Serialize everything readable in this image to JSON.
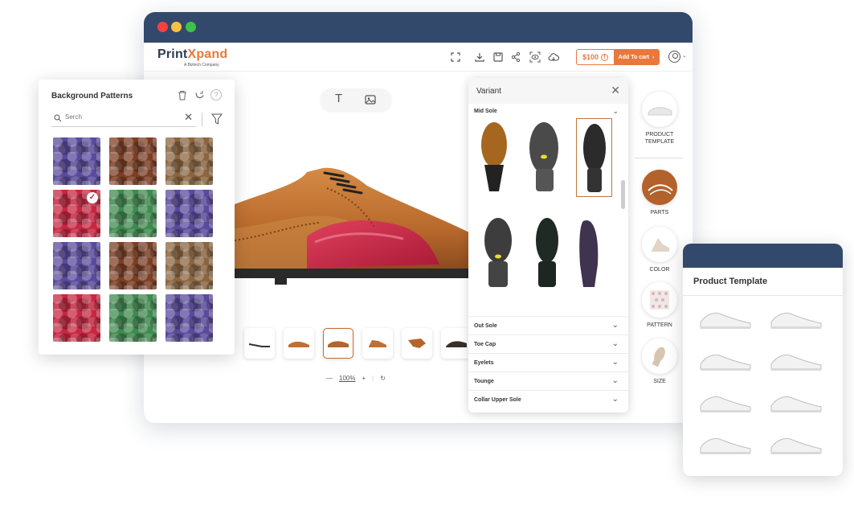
{
  "window": {
    "logo_main": "Print",
    "logo_accent": "Xpand",
    "logo_sub": "A Biztech Company"
  },
  "toolbar": {
    "icons": [
      "fullscreen-icon",
      "download-icon",
      "save-icon",
      "share-icon",
      "preview-icon",
      "cloud-icon"
    ],
    "price": "$100",
    "add_to_cart": "Add To cart"
  },
  "canvas": {
    "tools": [
      "text-tool-icon",
      "image-tool-icon"
    ],
    "zoom": "100%"
  },
  "variant": {
    "title": "Variant",
    "section": "Mid Sole",
    "accordions": [
      "Out Sole",
      "Toe Cap",
      "Eyelets",
      "Tounge",
      "Collar Upper Sole"
    ]
  },
  "side_menu": [
    {
      "label": "PRODUCT TEMPLATE"
    },
    {
      "label": "PARTS"
    },
    {
      "label": "COLOR"
    },
    {
      "label": "PATTERN"
    },
    {
      "label": "SIZE"
    }
  ],
  "bg_panel": {
    "title": "Background Patterns",
    "search_placeholder": "Serch",
    "selected_index": 3
  },
  "patterns": [
    {
      "name": "purple-croc",
      "color": "#5b4a9c"
    },
    {
      "name": "brown-leather",
      "color": "#7c3f24"
    },
    {
      "name": "tan-croc",
      "color": "#8b6540"
    },
    {
      "name": "red-croc",
      "color": "#c72741"
    },
    {
      "name": "green-croc",
      "color": "#3f8a4f"
    },
    {
      "name": "purple-croc",
      "color": "#5b4a9c"
    },
    {
      "name": "purple-croc",
      "color": "#5b4a9c"
    },
    {
      "name": "brown-leather",
      "color": "#7c3f24"
    },
    {
      "name": "tan-croc",
      "color": "#8b6540"
    },
    {
      "name": "red-croc",
      "color": "#c72741"
    },
    {
      "name": "green-croc",
      "color": "#3f8a4f"
    },
    {
      "name": "purple-croc",
      "color": "#5b4a9c"
    }
  ],
  "product_template": {
    "title": "Product Template"
  }
}
